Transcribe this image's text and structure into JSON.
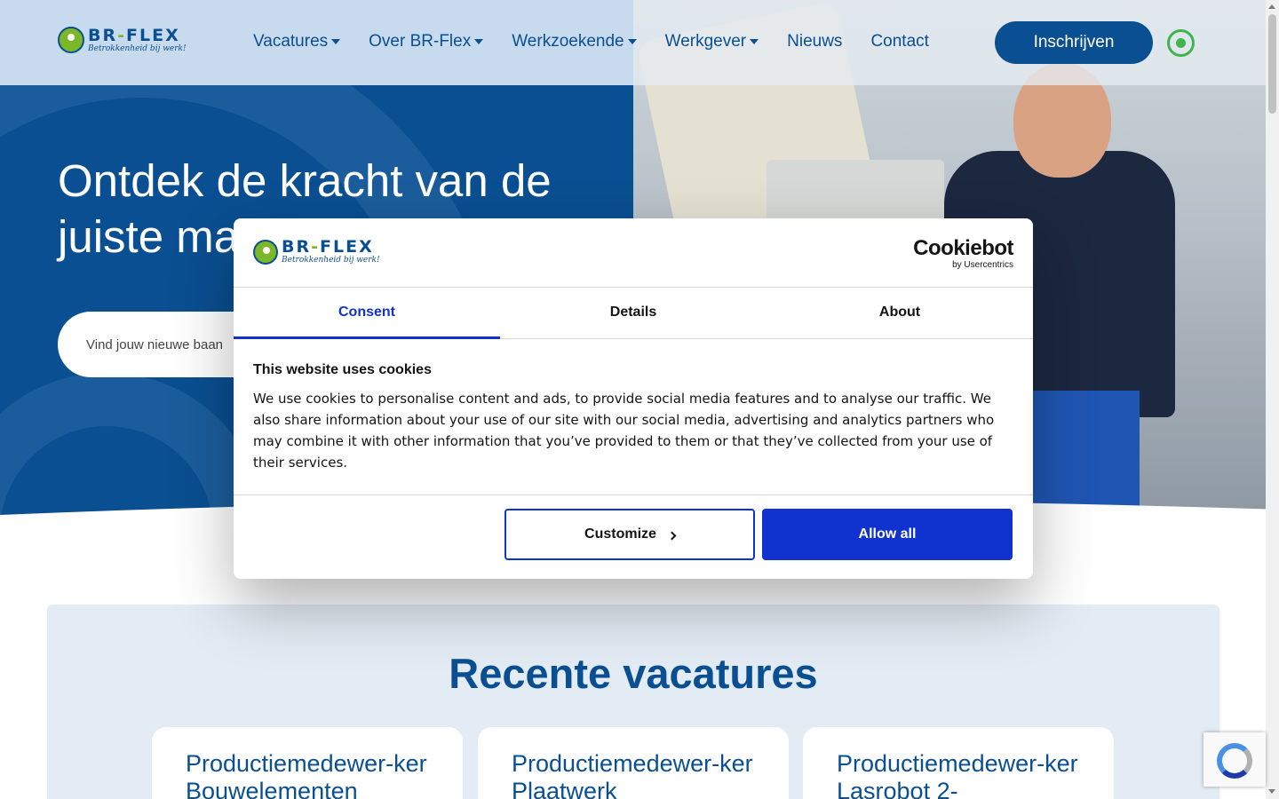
{
  "header": {
    "logo": {
      "name": "BR-FLEX",
      "tagline": "Betrokkenheid bij werk!"
    },
    "nav": [
      {
        "label": "Vacatures",
        "dropdown": true
      },
      {
        "label": "Over BR-Flex",
        "dropdown": true
      },
      {
        "label": "Werkzoekende",
        "dropdown": true
      },
      {
        "label": "Werkgever",
        "dropdown": true
      },
      {
        "label": "Nieuws",
        "dropdown": false
      },
      {
        "label": "Contact",
        "dropdown": false
      }
    ],
    "cta_label": "Inschrijven",
    "whatsapp_icon": "whatsapp-icon"
  },
  "hero": {
    "title": "Ontdek de kracht van de juiste match",
    "search_placeholder": "Vind jouw nieuwe baan"
  },
  "vacatures": {
    "title": "Recente vacatures",
    "cards": [
      {
        "title": "Productiemedewer-ker Bouwelementen"
      },
      {
        "title": "Productiemedewer-ker Plaatwerk"
      },
      {
        "title": "Productiemedewer-ker Lasrobot 2-"
      }
    ]
  },
  "cookie_dialog": {
    "logo": {
      "name": "BR-FLEX",
      "tagline": "Betrokkenheid bij werk!"
    },
    "provider": {
      "name": "Cookiebot",
      "sub": "by Usercentrics"
    },
    "tabs": [
      {
        "label": "Consent",
        "active": true
      },
      {
        "label": "Details",
        "active": false
      },
      {
        "label": "About",
        "active": false
      }
    ],
    "heading": "This website uses cookies",
    "body": "We use cookies to personalise content and ads, to provide social media features and to analyse our traffic. We also share information about your use of our site with our social media, advertising and analytics partners who may combine it with other information that you’ve provided to them or that they’ve collected from your use of their services.",
    "customize_label": "Customize",
    "allow_label": "Allow all"
  },
  "colors": {
    "brand_blue": "#0a4f91",
    "brand_green": "#7bb828",
    "cookiebot_blue": "#1032cf",
    "whatsapp_green": "#3fb54a"
  }
}
